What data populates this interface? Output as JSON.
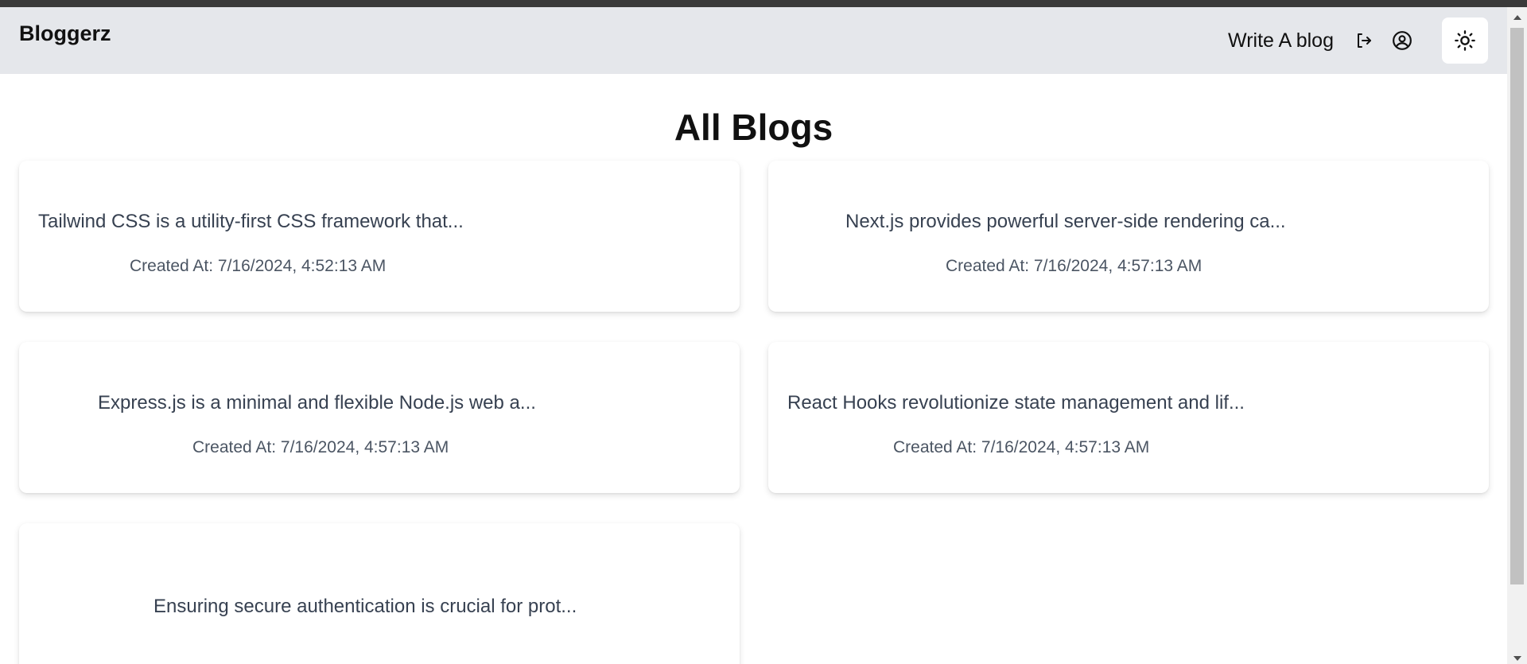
{
  "navbar": {
    "brand": "Bloggerz",
    "write_link": "Write A blog",
    "icons": [
      "logout-icon",
      "user-circle-icon",
      "sun-icon"
    ]
  },
  "main": {
    "title": "All Blogs",
    "created_prefix": "Created At: ",
    "blogs": [
      {
        "excerpt": "Tailwind CSS is a utility-first CSS framework that...",
        "created": "Created At: 7/16/2024, 4:52:13 AM"
      },
      {
        "excerpt": "Next.js provides powerful server-side rendering ca...",
        "created": "Created At: 7/16/2024, 4:57:13 AM"
      },
      {
        "excerpt": "Express.js is a minimal and flexible Node.js web a...",
        "created": "Created At: 7/16/2024, 4:57:13 AM"
      },
      {
        "excerpt": "React Hooks revolutionize state management and lif...",
        "created": "Created At: 7/16/2024, 4:57:13 AM"
      },
      {
        "excerpt": "Ensuring secure authentication is crucial for prot...",
        "created": ""
      }
    ]
  },
  "colors": {
    "navbar_bg": "#e5e7eb",
    "card_bg": "#ffffff",
    "text_muted": "#4b5563",
    "window_strip": "#3a3a3a"
  }
}
